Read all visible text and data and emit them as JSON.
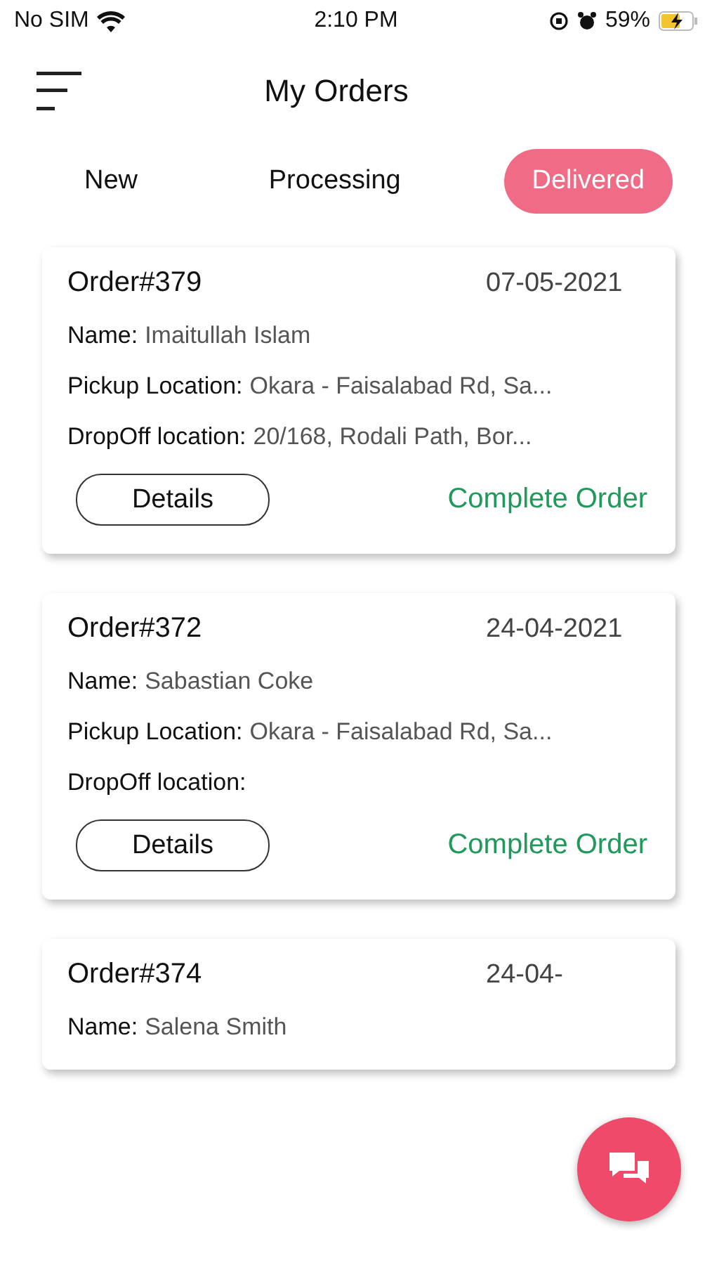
{
  "status_bar": {
    "carrier": "No SIM",
    "time": "2:10 PM",
    "battery": "59%"
  },
  "header": {
    "title": "My Orders"
  },
  "tabs": [
    {
      "label": "New",
      "selected": false
    },
    {
      "label": "Processing",
      "selected": false
    },
    {
      "label": "Delivered",
      "selected": true
    }
  ],
  "orders": [
    {
      "number": "Order#379",
      "date": "07-05-2021",
      "fields": [
        {
          "label": "Name:",
          "value": "Imaitullah Islam"
        },
        {
          "label": "Pickup Location:",
          "value": "Okara - Faisalabad Rd, Sa..."
        },
        {
          "label": "DropOff location:",
          "value": "20/168, Rodali Path, Bor..."
        }
      ],
      "details_button": "Details",
      "action": "Complete Order"
    },
    {
      "number": "Order#372",
      "date": "24-04-2021",
      "fields": [
        {
          "label": "Name:",
          "value": "Sabastian Coke"
        },
        {
          "label": "Pickup Location:",
          "value": "Okara - Faisalabad Rd, Sa..."
        },
        {
          "label": "DropOff location:"
        }
      ],
      "details_button": "Details",
      "action": "Complete Order"
    },
    {
      "number": "Order#374",
      "date": "24-04-",
      "fields": [
        {
          "label": "Name:",
          "value": "Salena Smith"
        }
      ]
    }
  ]
}
